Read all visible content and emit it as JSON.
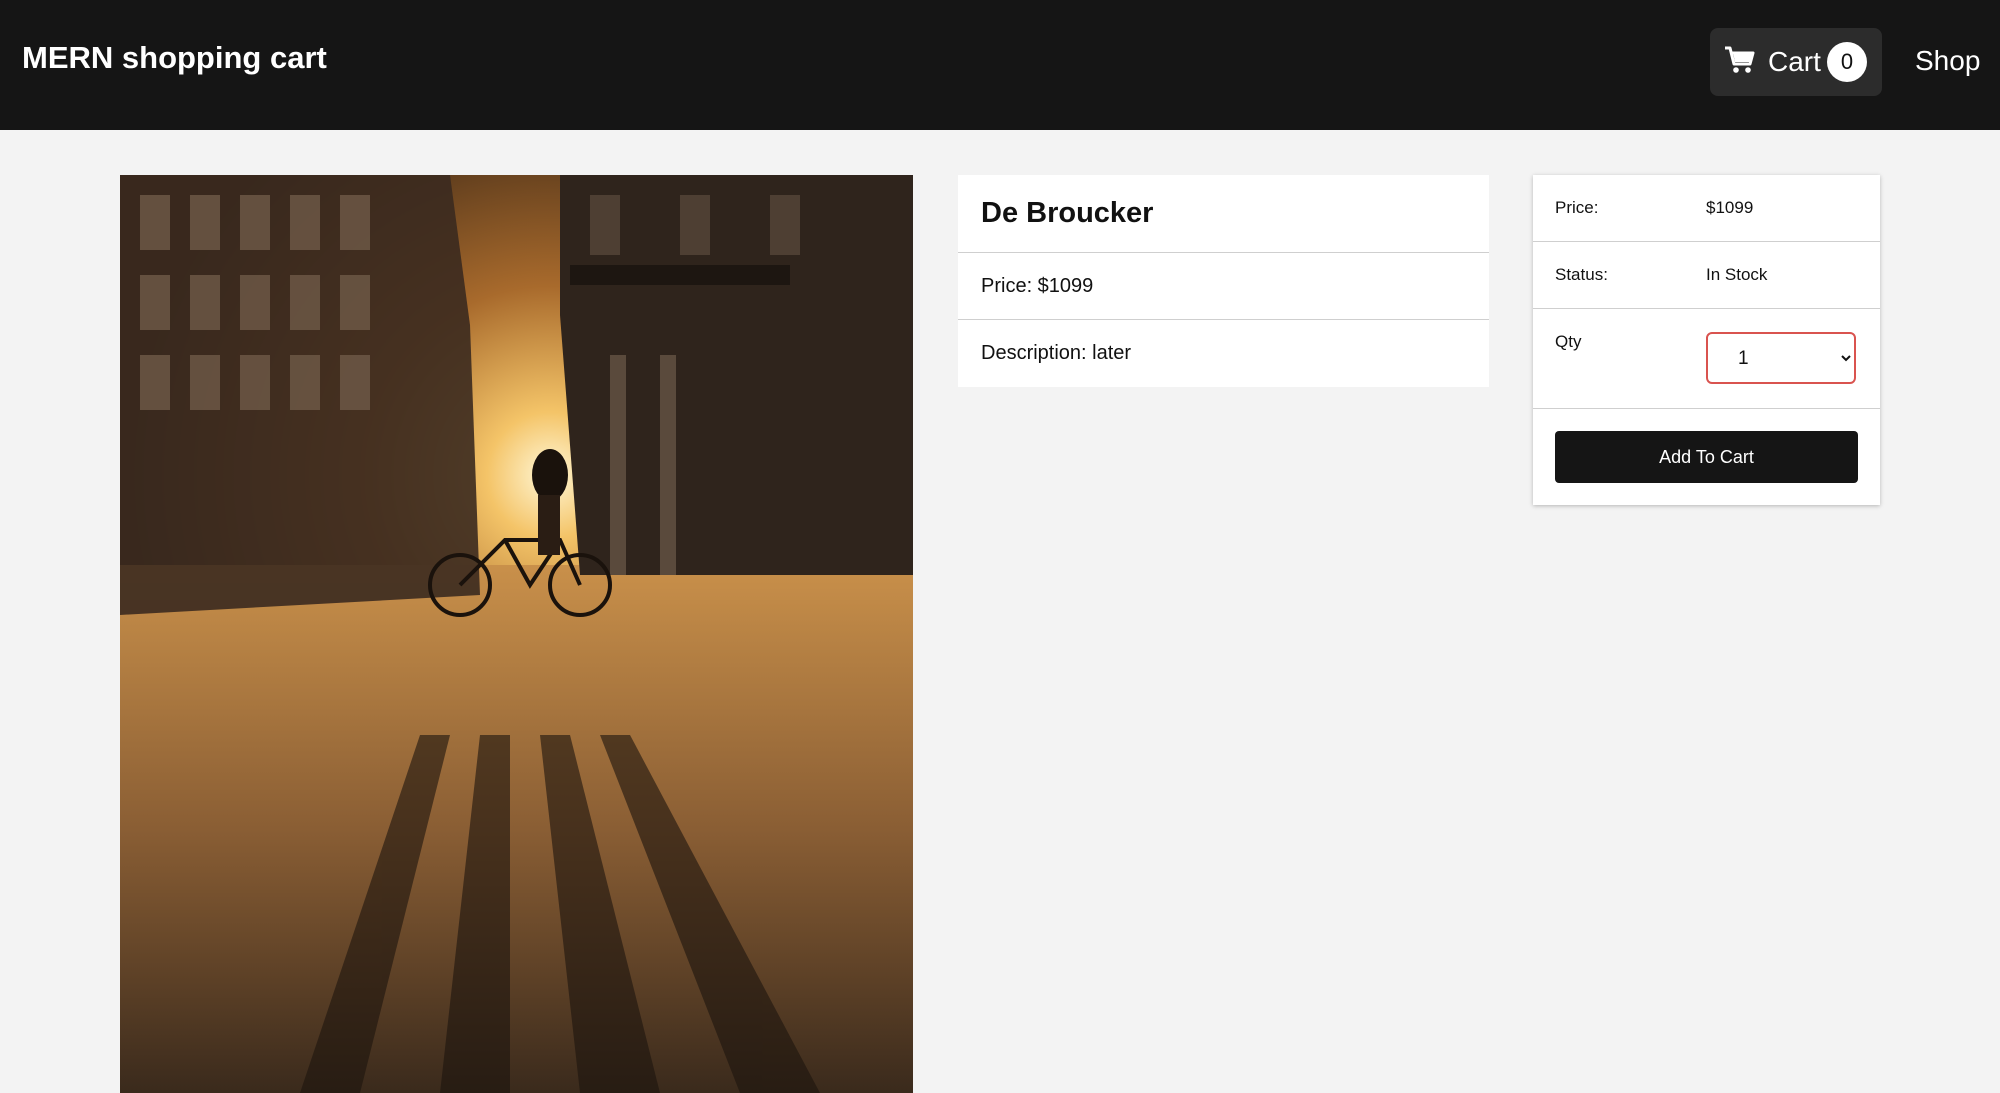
{
  "header": {
    "brand": "MERN shopping cart",
    "cart_label": "Cart",
    "cart_count": "0",
    "cart_icon": "shopping-cart-icon",
    "shop_label": "Shop"
  },
  "product": {
    "image_alt": "De Broucker",
    "name": "De Broucker",
    "price_text": "Price: $1099",
    "description_text": "Description: later"
  },
  "purchase": {
    "price_label": "Price:",
    "price_value": "$1099",
    "status_label": "Status:",
    "status_value": "In Stock",
    "qty_label": "Qty",
    "qty_selected": "1",
    "add_to_cart_label": "Add To Cart"
  },
  "colors": {
    "header_bg": "#151515",
    "page_bg": "#f3f3f3",
    "button_bg": "#151515",
    "select_border": "#d9534f"
  }
}
